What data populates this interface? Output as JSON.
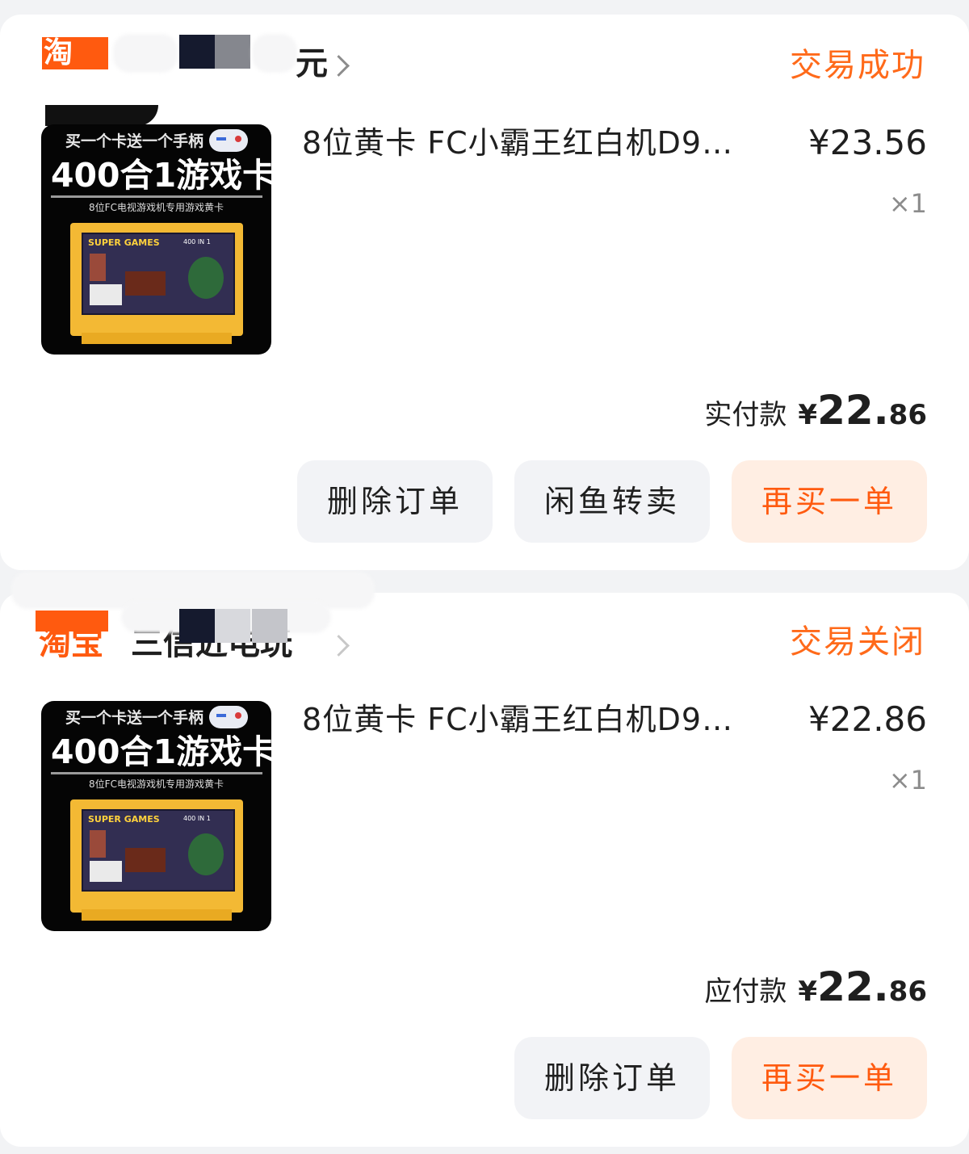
{
  "orders": [
    {
      "shop_logo": "淘",
      "shop_name_visible": "元",
      "status": "交易成功",
      "item": {
        "promo_text": "买一个卡送一个手柄",
        "big_text": "400合1游戏卡",
        "sub_text": "8位FC电视游戏机专用游戏黄卡",
        "label_title": "SUPER GAMES",
        "label_sub": "400 IN 1",
        "title": "8位黄卡 FC小霸王红白机D9…",
        "price": "¥23.56",
        "qty": "×1"
      },
      "pay_label": "实付款",
      "pay_currency": "¥",
      "pay_int": "22.",
      "pay_dec": "86",
      "buttons": [
        "删除订单",
        "闲鱼转卖",
        "再买一单"
      ]
    },
    {
      "shop_logo": "淘宝",
      "shop_name_visible": "三信近电玩",
      "status": "交易关闭",
      "item": {
        "promo_text": "买一个卡送一个手柄",
        "big_text": "400合1游戏卡",
        "sub_text": "8位FC电视游戏机专用游戏黄卡",
        "label_title": "SUPER GAMES",
        "label_sub": "400 IN 1",
        "title": "8位黄卡 FC小霸王红白机D9…",
        "price": "¥22.86",
        "qty": "×1"
      },
      "pay_label": "应付款",
      "pay_currency": "¥",
      "pay_int": "22.",
      "pay_dec": "86",
      "buttons": [
        "删除订单",
        "再买一单"
      ]
    }
  ],
  "colors": {
    "accent": "#ff5a0f",
    "status": "#ff6a1a",
    "button_bg": "#f2f3f6",
    "button_hot_bg": "#ffeee3",
    "page_bg": "#f2f3f5"
  }
}
